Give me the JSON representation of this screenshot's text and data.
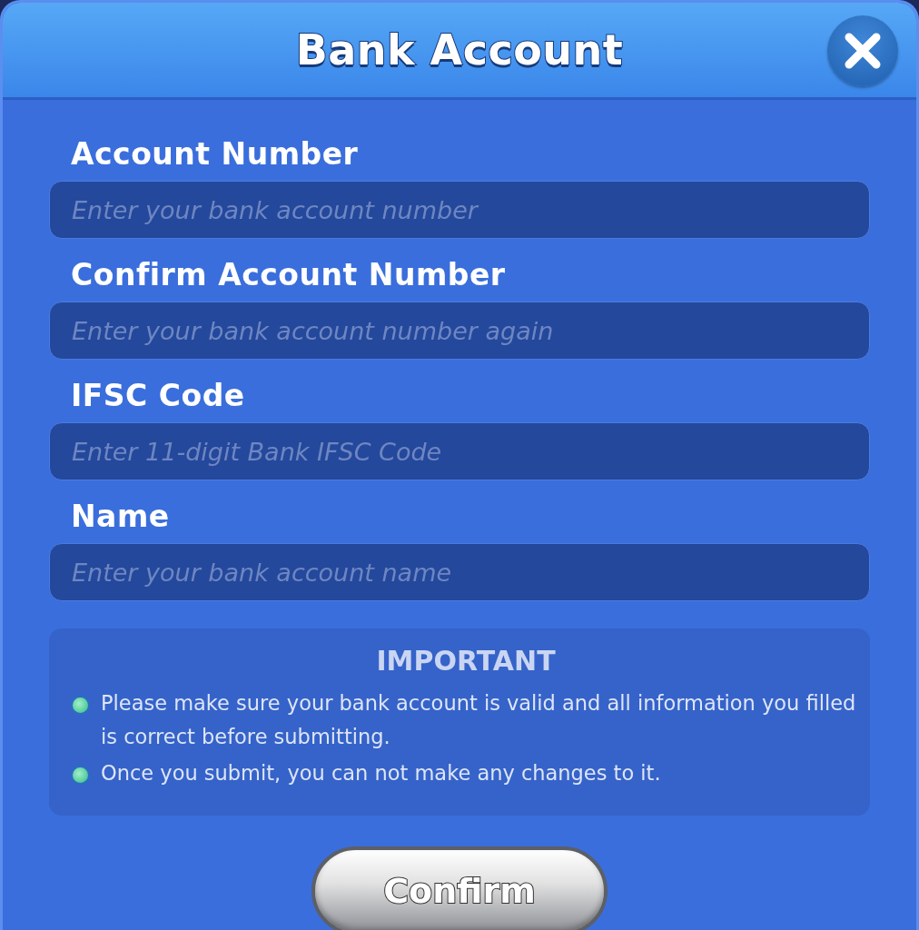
{
  "dialog": {
    "title": "Bank Account"
  },
  "fields": [
    {
      "label": "Account Number",
      "placeholder": "Enter your bank account number"
    },
    {
      "label": "Confirm Account Number",
      "placeholder": "Enter your bank account number again"
    },
    {
      "label": "IFSC Code",
      "placeholder": "Enter 11-digit Bank IFSC Code"
    },
    {
      "label": "Name",
      "placeholder": "Enter your bank account name"
    }
  ],
  "notice": {
    "title": "IMPORTANT",
    "items": [
      "Please make sure your bank account is valid and all information you filled is correct before submitting.",
      "Once you submit, you can not make any changes to it."
    ]
  },
  "buttons": [
    "Confirm"
  ]
}
